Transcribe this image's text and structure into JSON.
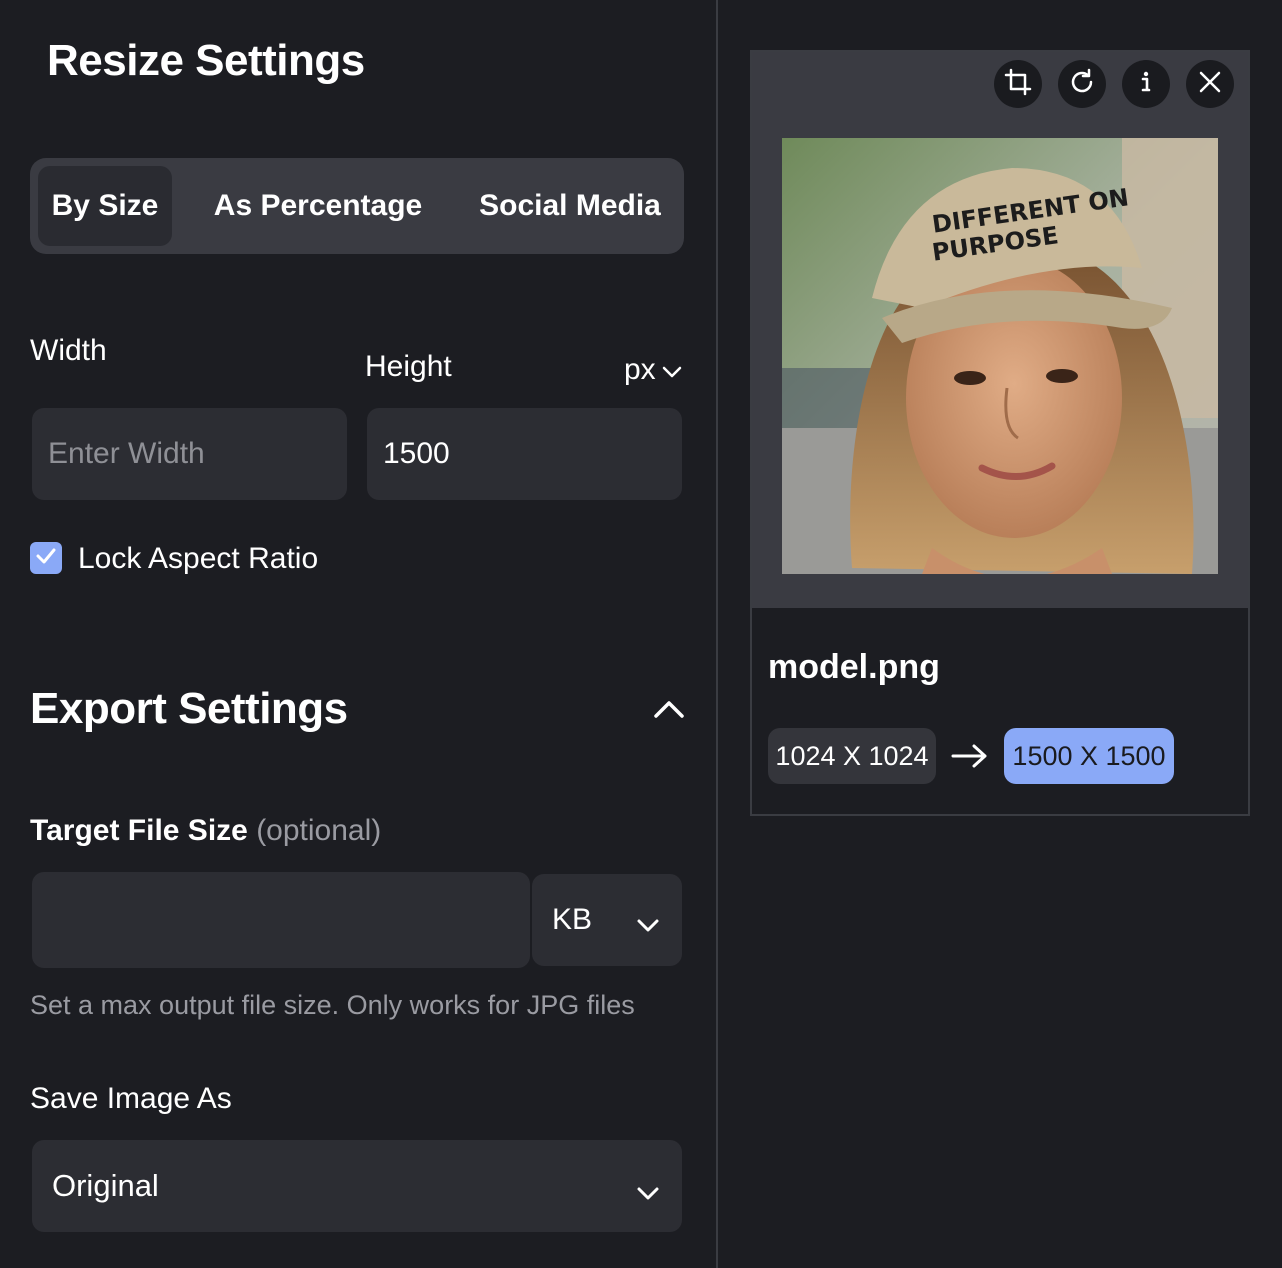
{
  "left": {
    "title": "Resize Settings",
    "tabs": [
      {
        "label": "By Size",
        "active": true
      },
      {
        "label": "As Percentage",
        "active": false
      },
      {
        "label": "Social Media",
        "active": false
      }
    ],
    "width_label": "Width",
    "height_label": "Height",
    "unit": "px",
    "width_placeholder": "Enter Width",
    "width_value": "",
    "height_value": "1500",
    "lock_aspect_label": "Lock Aspect Ratio",
    "lock_aspect_checked": true,
    "export_title": "Export Settings",
    "target_label": "Target File Size",
    "target_optional": "(optional)",
    "target_value": "",
    "target_unit": "KB",
    "target_helper": "Set a max output file size. Only works for JPG files",
    "save_as_label": "Save Image As",
    "save_as_value": "Original"
  },
  "right": {
    "filename": "model.png",
    "original_size": "1024 X 1024",
    "new_size": "1500 X 1500",
    "actions": [
      "crop-icon",
      "rotate-icon",
      "info-icon",
      "close-icon"
    ],
    "cap_text_line1": "DIFFERENT ON",
    "cap_text_line2": "PURPOSE"
  },
  "colors": {
    "background": "#1c1d22",
    "surface": "#2c2d33",
    "accent": "#8aa9f7"
  }
}
